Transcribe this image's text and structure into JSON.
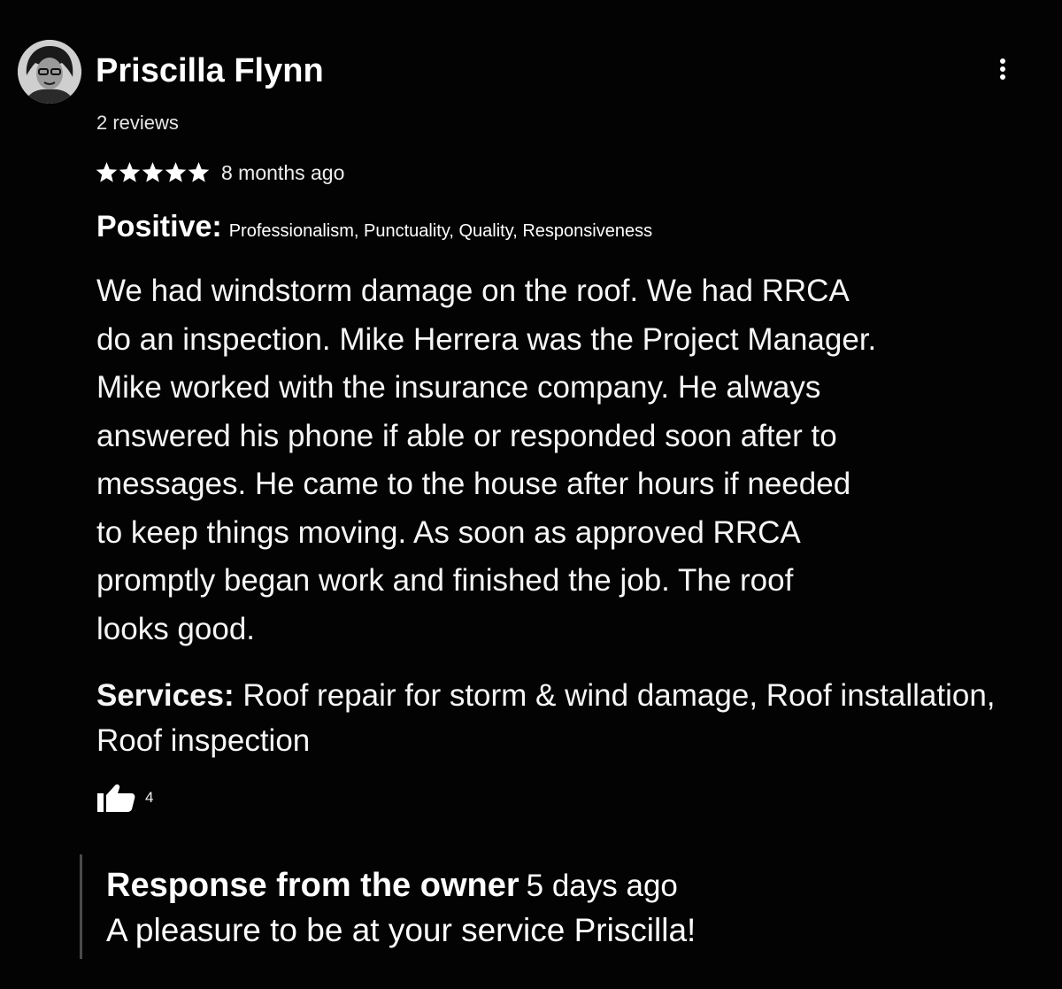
{
  "reviewer": {
    "name": "Priscilla Flynn",
    "review_count": "2 reviews",
    "avatar_icon": "user-avatar-photo"
  },
  "menu": {
    "icon": "more-vertical-icon"
  },
  "rating": {
    "stars": 5,
    "max_stars": 5,
    "time_ago": "8 months ago"
  },
  "positive": {
    "label": "Positive:",
    "tags": "Professionalism, Punctuality, Quality, Responsiveness"
  },
  "review_text": "We had windstorm damage on the roof. We had RRCA\ndo an inspection. Mike Herrera was the Project Manager.\nMike worked with the insurance company.  He always\nanswered his phone if able or responded soon after to\nmessages.  He came to the house after hours if needed\nto keep things moving.  As soon as approved RRCA\npromptly began work and finished the job.  The roof\nlooks good.",
  "services": {
    "label": "Services:",
    "text": "Roof repair for storm & wind damage, Roof installation, Roof inspection"
  },
  "likes": {
    "icon": "thumbs-up-icon",
    "count": "4"
  },
  "owner_response": {
    "label": "Response from the owner",
    "time_ago": "5 days ago",
    "message": "A pleasure to be at your service Priscilla!"
  },
  "colors": {
    "background": "#030303",
    "text": "#ffffff",
    "response_border": "#4a4a4a"
  }
}
